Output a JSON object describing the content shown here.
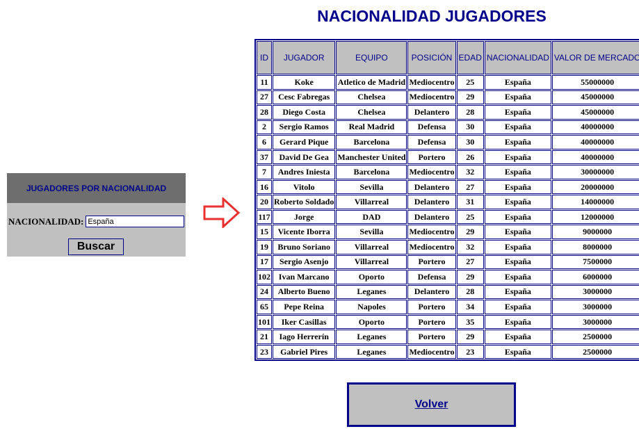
{
  "search_panel": {
    "title": "JUGADORES POR NACIONALIDAD",
    "label": "NACIONALIDAD:",
    "input_value": "España",
    "button_label": "Buscar"
  },
  "arrow_icon": "right-arrow-icon",
  "arrow_color": "#e8312f",
  "title": "NACIONALIDAD JUGADORES",
  "table": {
    "headers": [
      "ID",
      "JUGADOR",
      "EQUIPO",
      "POSICIÓN",
      "EDAD",
      "NACIONALIDAD",
      "VALOR DE MERCADO"
    ],
    "rows": [
      [
        "11",
        "Koke",
        "Atletico de Madrid",
        "Mediocentro",
        "25",
        "España",
        "55000000"
      ],
      [
        "27",
        "Cesc Fabregas",
        "Chelsea",
        "Mediocentro",
        "29",
        "España",
        "45000000"
      ],
      [
        "28",
        "Diego Costa",
        "Chelsea",
        "Delantero",
        "28",
        "España",
        "45000000"
      ],
      [
        "2",
        "Sergio Ramos",
        "Real Madrid",
        "Defensa",
        "30",
        "España",
        "40000000"
      ],
      [
        "6",
        "Gerard Pique",
        "Barcelona",
        "Defensa",
        "30",
        "España",
        "40000000"
      ],
      [
        "37",
        "David De Gea",
        "Manchester United",
        "Portero",
        "26",
        "España",
        "40000000"
      ],
      [
        "7",
        "Andres Iniesta",
        "Barcelona",
        "Mediocentro",
        "32",
        "España",
        "30000000"
      ],
      [
        "16",
        "Vitolo",
        "Sevilla",
        "Delantero",
        "27",
        "España",
        "20000000"
      ],
      [
        "20",
        "Roberto Soldado",
        "Villarreal",
        "Delantero",
        "31",
        "España",
        "14000000"
      ],
      [
        "117",
        "Jorge",
        "DAD",
        "Delantero",
        "25",
        "España",
        "12000000"
      ],
      [
        "15",
        "Vicente Iborra",
        "Sevilla",
        "Mediocentro",
        "29",
        "España",
        "9000000"
      ],
      [
        "19",
        "Bruno Soriano",
        "Villarreal",
        "Mediocentro",
        "32",
        "España",
        "8000000"
      ],
      [
        "17",
        "Sergio Asenjo",
        "Villarreal",
        "Portero",
        "27",
        "España",
        "7500000"
      ],
      [
        "102",
        "Ivan Marcano",
        "Oporto",
        "Defensa",
        "29",
        "España",
        "6000000"
      ],
      [
        "24",
        "Alberto Bueno",
        "Leganes",
        "Delantero",
        "28",
        "España",
        "3000000"
      ],
      [
        "65",
        "Pepe Reina",
        "Napoles",
        "Portero",
        "34",
        "España",
        "3000000"
      ],
      [
        "101",
        "Iker Casillas",
        "Oporto",
        "Portero",
        "35",
        "España",
        "3000000"
      ],
      [
        "21",
        "Iago Herrerín",
        "Leganes",
        "Portero",
        "29",
        "España",
        "2500000"
      ],
      [
        "23",
        "Gabriel Pires",
        "Leganes",
        "Mediocentro",
        "23",
        "España",
        "2500000"
      ]
    ]
  },
  "back_button_label": "Volver",
  "colors": {
    "accent": "#00008b",
    "panel": "#c0c0c0",
    "panel_header": "#6e6e6e"
  }
}
